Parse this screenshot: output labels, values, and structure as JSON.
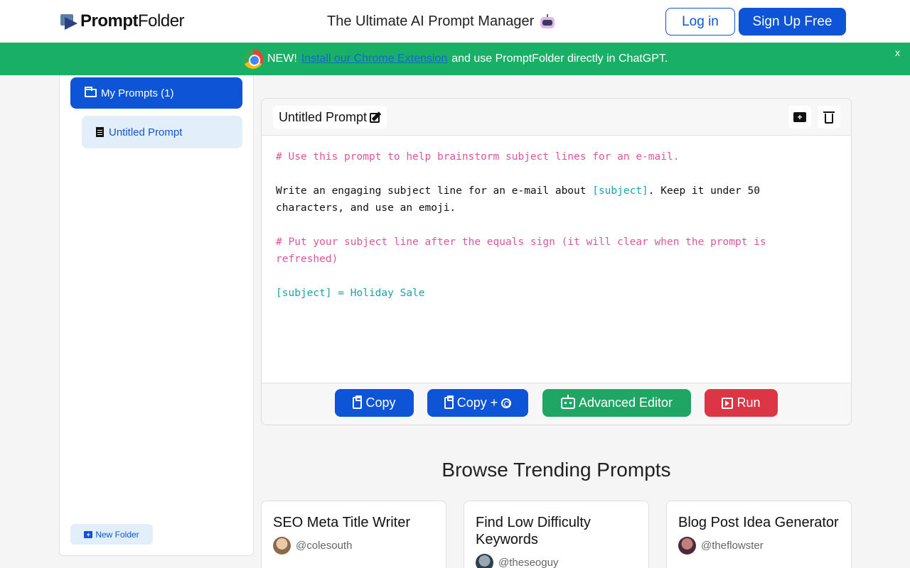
{
  "header": {
    "logo_bold": "Prompt",
    "logo_thin": "Folder",
    "tagline": "The Ultimate AI Prompt Manager",
    "login_label": "Log in",
    "signup_label": "Sign Up Free"
  },
  "banner": {
    "new_label": "NEW!",
    "link_text": "Install our Chrome Extension",
    "rest_text": "and use PromptFolder directly in ChatGPT.",
    "close_label": "x"
  },
  "sidebar": {
    "folder_label": "My Prompts (1)",
    "prompt_item_label": "Untitled Prompt",
    "new_folder_label": "New Folder"
  },
  "editor": {
    "title": "Untitled Prompt",
    "line1": "# Use this prompt to help brainstorm subject lines for an e-mail.",
    "line2_a": "Write an engaging subject line for an e-mail about ",
    "line2_var": "[subject]",
    "line2_b": ". Keep it under 50 characters, and use an emoji.",
    "line3": "# Put your subject line after the equals sign (it will clear when the prompt is refreshed)",
    "line4": "[subject] = Holiday Sale",
    "buttons": {
      "copy": "Copy",
      "copy_plus": "Copy +",
      "advanced": "Advanced Editor",
      "run": "Run"
    }
  },
  "trending": {
    "heading": "Browse Trending Prompts",
    "cards": [
      {
        "title": "SEO Meta Title Writer",
        "author": "@colesouth"
      },
      {
        "title": "Find Low Difficulty Keywords",
        "author": "@theseoguy"
      },
      {
        "title": "Blog Post Idea Generator",
        "author": "@theflowster"
      }
    ]
  },
  "colors": {
    "primary": "#0d55d6",
    "banner_green": "#1aaf66",
    "advanced_green": "#1fa564",
    "run_red": "#dc3545",
    "comment_pink": "#e0559a",
    "variable_teal": "#1aa3a8"
  }
}
